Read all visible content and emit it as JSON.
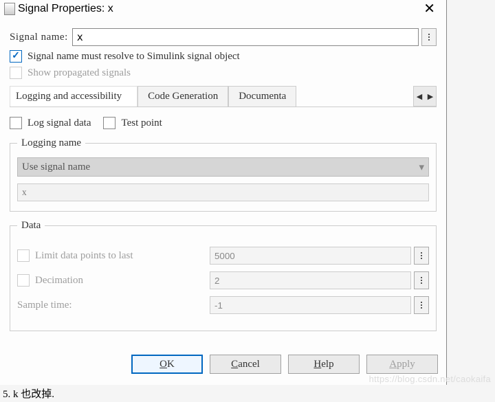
{
  "title": "Signal Properties: x",
  "signalName": {
    "label": "Signal name:",
    "value": "x"
  },
  "cbResolve": {
    "label": "Signal name must resolve to Simulink signal object",
    "checked": true,
    "enabled": true
  },
  "cbShowProp": {
    "label": "Show propagated signals",
    "checked": false,
    "enabled": false
  },
  "tabs": {
    "t0": "Logging and accessibility",
    "t1": "Code Generation",
    "t2": "Documenta"
  },
  "cbLog": {
    "label": "Log signal data",
    "checked": false
  },
  "cbTest": {
    "label": "Test point",
    "checked": false
  },
  "loggingName": {
    "legend": "Logging name",
    "mode": "Use signal name",
    "value": "x"
  },
  "data": {
    "legend": "Data",
    "limit": {
      "label": "Limit data points to last",
      "value": "5000",
      "checked": false,
      "enabled": false
    },
    "decim": {
      "label": "Decimation",
      "value": "2",
      "checked": false,
      "enabled": false
    },
    "sample": {
      "label": "Sample time:",
      "value": "-1",
      "enabled": false
    }
  },
  "buttons": {
    "ok": {
      "prefix": "",
      "ul": "O",
      "suffix": "K"
    },
    "cancel": {
      "prefix": "",
      "ul": "C",
      "suffix": "ancel"
    },
    "help": {
      "prefix": "",
      "ul": "H",
      "suffix": "elp"
    },
    "apply": {
      "prefix": "",
      "ul": "A",
      "suffix": "pply"
    }
  },
  "footer": "5. k 也改掉.",
  "watermark": "https://blog.csdn.net/caokaifa"
}
